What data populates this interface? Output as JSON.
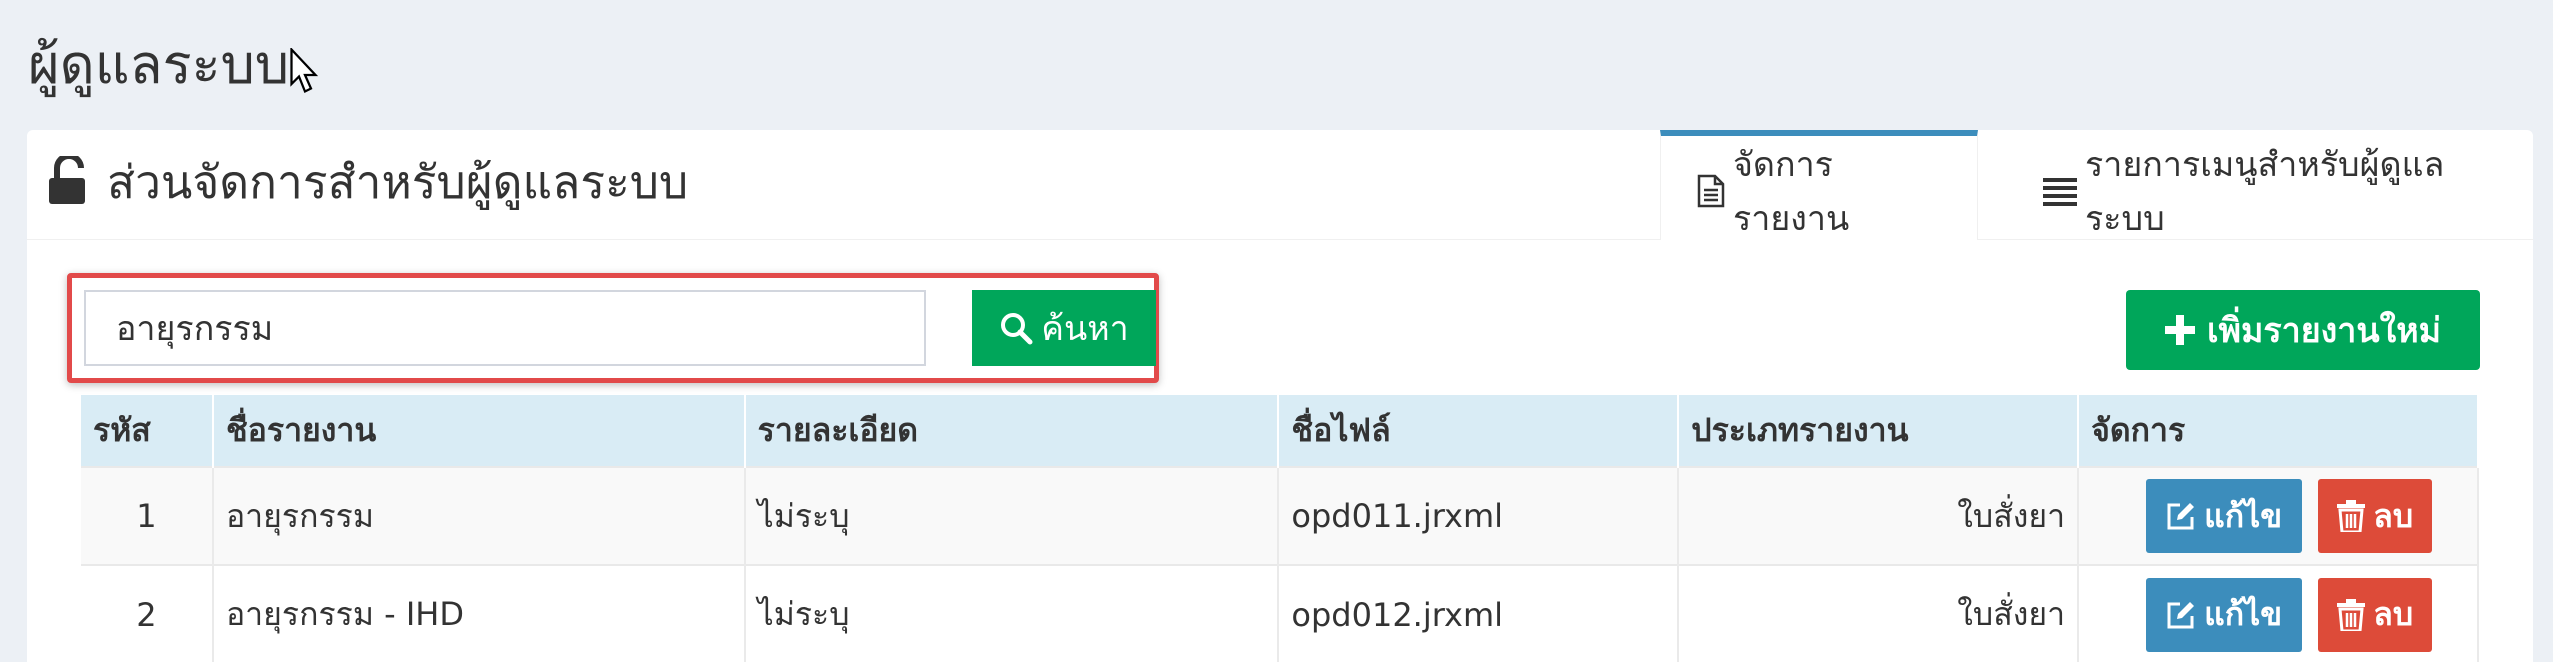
{
  "page": {
    "title": "ผู้ดูแลระบบ"
  },
  "box": {
    "title": "ส่วนจัดการสำหรับผู้ดูแลระบบ"
  },
  "tabs": [
    {
      "label": "จัดการรายงาน",
      "icon": "file-text-icon",
      "active": true
    },
    {
      "label": "รายการเมนูสำหรับผู้ดูแลระบบ",
      "icon": "list-icon",
      "active": false
    }
  ],
  "search": {
    "value": "อายุรกรรม",
    "button_label": "ค้นหา"
  },
  "add_button": {
    "label": "เพิ่มรายงานใหม่"
  },
  "table": {
    "headers": [
      "รหัส",
      "ชื่อรายงาน",
      "รายละเอียด",
      "ชื่อไฟล์",
      "ประเภทรายงาน",
      "จัดการ"
    ],
    "rows": [
      {
        "id": "1",
        "name": "อายุรกรรม",
        "detail": "ไม่ระบุ",
        "file": "opd011.jrxml",
        "type": "ใบสั่งยา"
      },
      {
        "id": "2",
        "name": "อายุรกรรม - IHD",
        "detail": "ไม่ระบุ",
        "file": "opd012.jrxml",
        "type": "ใบสั่งยา"
      }
    ],
    "edit_label": "แก้ไข",
    "delete_label": "ลบ"
  },
  "colors": {
    "accent": "#3c8dbc",
    "success": "#00a65a",
    "danger": "#dd4b39",
    "highlight": "#e24a4a"
  }
}
